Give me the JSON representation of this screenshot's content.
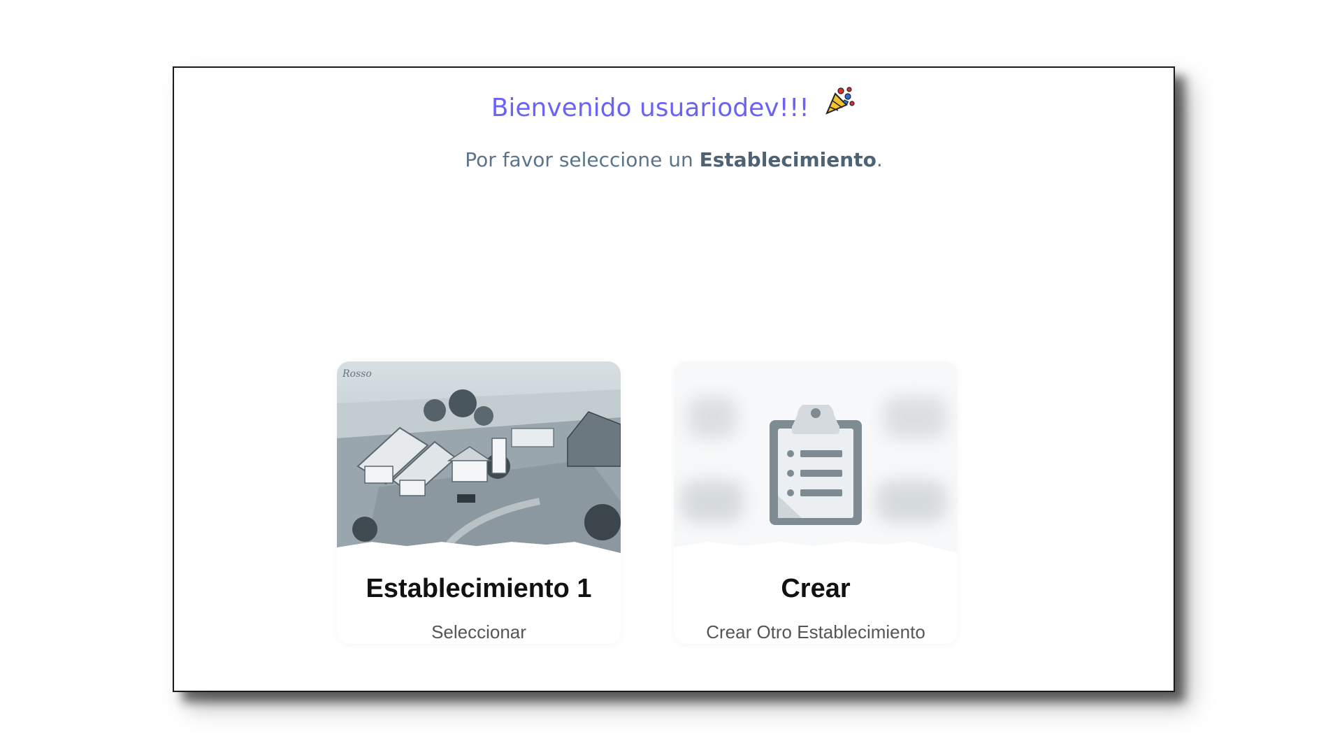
{
  "header": {
    "welcome_text": "Bienvenido usuariodev!!!",
    "subtitle_prefix": "Por favor seleccione un ",
    "subtitle_bold": "Establecimiento",
    "subtitle_suffix": "."
  },
  "cards": [
    {
      "title": "Establecimiento 1",
      "action_label": "Seleccionar",
      "watermark": "Rosso",
      "image_icon": "farm-aerial-photo"
    },
    {
      "title": "Crear",
      "action_label": "Crear Otro Establecimiento",
      "image_icon": "clipboard-icon"
    }
  ],
  "colors": {
    "welcome": "#6b63f5",
    "subtitle": "#5b7489",
    "card_title": "#111111"
  }
}
